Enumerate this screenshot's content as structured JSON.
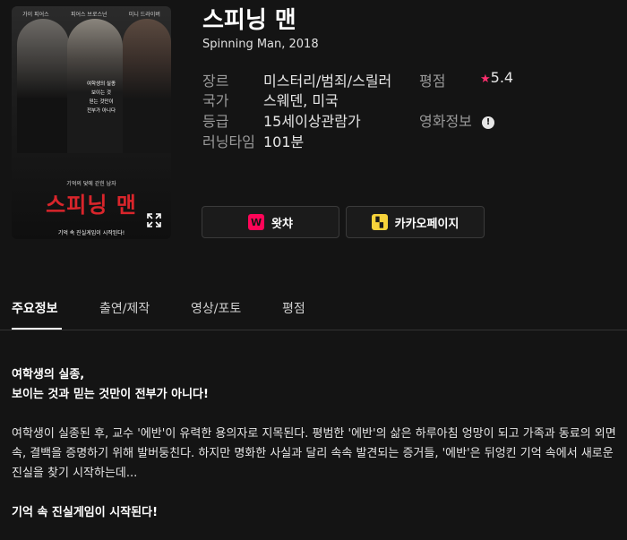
{
  "poster": {
    "actor_names": [
      "가이 피어스",
      "피어스 브로스넌",
      "미니 드라이버"
    ],
    "taglines": [
      "여학생의 실종",
      "보이는 것",
      "믿는 것만이",
      "전부가 아니다"
    ],
    "small_line": "기억의 덫에 갇힌 남자",
    "title": "스피닝 맨",
    "bottom_line": "기억 속 진실게임이 시작된다!"
  },
  "movie": {
    "title": "스피닝 맨",
    "subtitle": "Spinning Man, 2018"
  },
  "info": {
    "genre_label": "장르",
    "genre": "미스터리/범죄/스릴러",
    "country_label": "국가",
    "country": "스웨덴, 미국",
    "rating_label": "등급",
    "rating": "15세이상관람가",
    "runtime_label": "러닝타임",
    "runtime": "101분",
    "score_label": "평점",
    "score_star": "★",
    "score": "5.4",
    "movieinfo_label": "영화정보",
    "info_icon_glyph": "!"
  },
  "buttons": {
    "watcha_label": "왓챠",
    "watcha_logo": "W",
    "kakao_label": "카카오페이지",
    "kakao_logo": "▚"
  },
  "tabs": [
    "주요정보",
    "출연/제작",
    "영상/포토",
    "평점"
  ],
  "synopsis": {
    "heading1": "여학생의 실종,",
    "heading2": "보이는 것과 믿는 것만이 전부가 아니다!",
    "body": "여학생이 실종된 후, 교수 '에반'이 유력한 용의자로 지목된다. 평범한 '에반'의 삶은 하루아침 엉망이 되고 가족과 동료의 외면 속, 결백을 증명하기 위해 발버둥친다. 하지만 명화한 사실과 달리 속속 발견되는 증거들, '에반'은 뒤엉킨 기억 속에서 새로운 진실을 찾기 시작하는데...",
    "closing": "기억 속 진실게임이 시작된다!"
  },
  "colors": {
    "background": "#141414",
    "accent_star": "#ff2f6e",
    "watcha": "#ff0558",
    "kakao": "#f7d33b"
  }
}
